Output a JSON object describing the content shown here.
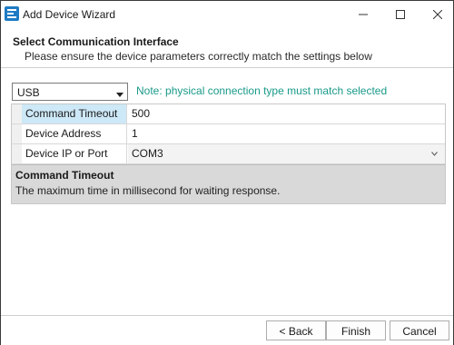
{
  "window": {
    "title": "Add Device Wizard",
    "icon": "wizard-app-icon"
  },
  "header": {
    "title": "Select Communication Interface",
    "subtitle": "Please ensure the device parameters correctly match the settings below"
  },
  "interface": {
    "selected": "USB",
    "note": "Note: physical connection type must match selected"
  },
  "properties": [
    {
      "label": "Command Timeout",
      "value": "500",
      "selected": true
    },
    {
      "label": "Device Address",
      "value": "1",
      "selected": false
    },
    {
      "label": "Device IP or Port",
      "value": "COM3",
      "selected": false
    }
  ],
  "help": {
    "title": "Command Timeout",
    "description": "The maximum time in millisecond for waiting response."
  },
  "footer": {
    "back_label": "< Back",
    "finish_label": "Finish",
    "cancel_label": "Cancel"
  },
  "colors": {
    "note": "#1a9a8a",
    "selected_row": "#cde8f7",
    "help_panel": "#d9d9d9"
  }
}
